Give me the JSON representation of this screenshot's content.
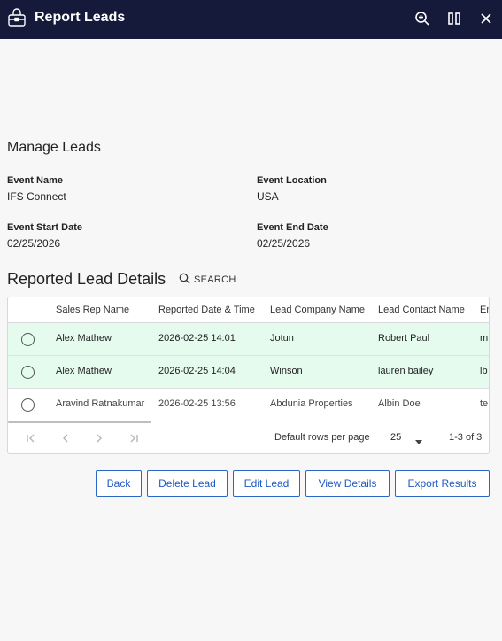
{
  "titlebar": {
    "title": "Report Leads",
    "icons": [
      "briefcase-lock-icon",
      "zoom-search-icon",
      "split-view-icon",
      "close-icon"
    ]
  },
  "manage": {
    "title": "Manage Leads",
    "event_name_label": "Event Name",
    "event_name": "IFS Connect",
    "event_location_label": "Event Location",
    "event_location": "USA",
    "event_start_label": "Event Start Date",
    "event_start": "02/25/2026",
    "event_end_label": "Event End Date",
    "event_end": "02/25/2026"
  },
  "leads": {
    "title": "Reported Lead Details",
    "search_label": "SEARCH",
    "columns": [
      "Sales Rep Name",
      "Reported Date & Time",
      "Lead Company Name",
      "Lead Contact Name",
      "Em"
    ],
    "rows": [
      {
        "rep": "Alex Mathew",
        "date": "2026-02-25 14:01",
        "company": "Jotun",
        "contact": "Robert Paul",
        "email": "m",
        "selected": true
      },
      {
        "rep": "Alex Mathew",
        "date": "2026-02-25 14:04",
        "company": "Winson",
        "contact": "lauren bailey",
        "email": "lb",
        "selected": true
      },
      {
        "rep": "Aravind Ratnakumar",
        "date": "2026-02-25 13:56",
        "company": "Abdunia Properties",
        "contact": "Albin Doe",
        "email": "te",
        "selected": false
      }
    ],
    "pager": {
      "rows_label": "Default rows per page",
      "rows_value": "25",
      "range": "1-3 of 3"
    }
  },
  "actions": {
    "back": "Back",
    "delete": "Delete Lead",
    "edit": "Edit Lead",
    "view": "View Details",
    "export": "Export Results"
  },
  "colors": {
    "titlebar_bg": "#15193a",
    "selected_row": "#e5fbee",
    "button_accent": "#1d59c4"
  }
}
